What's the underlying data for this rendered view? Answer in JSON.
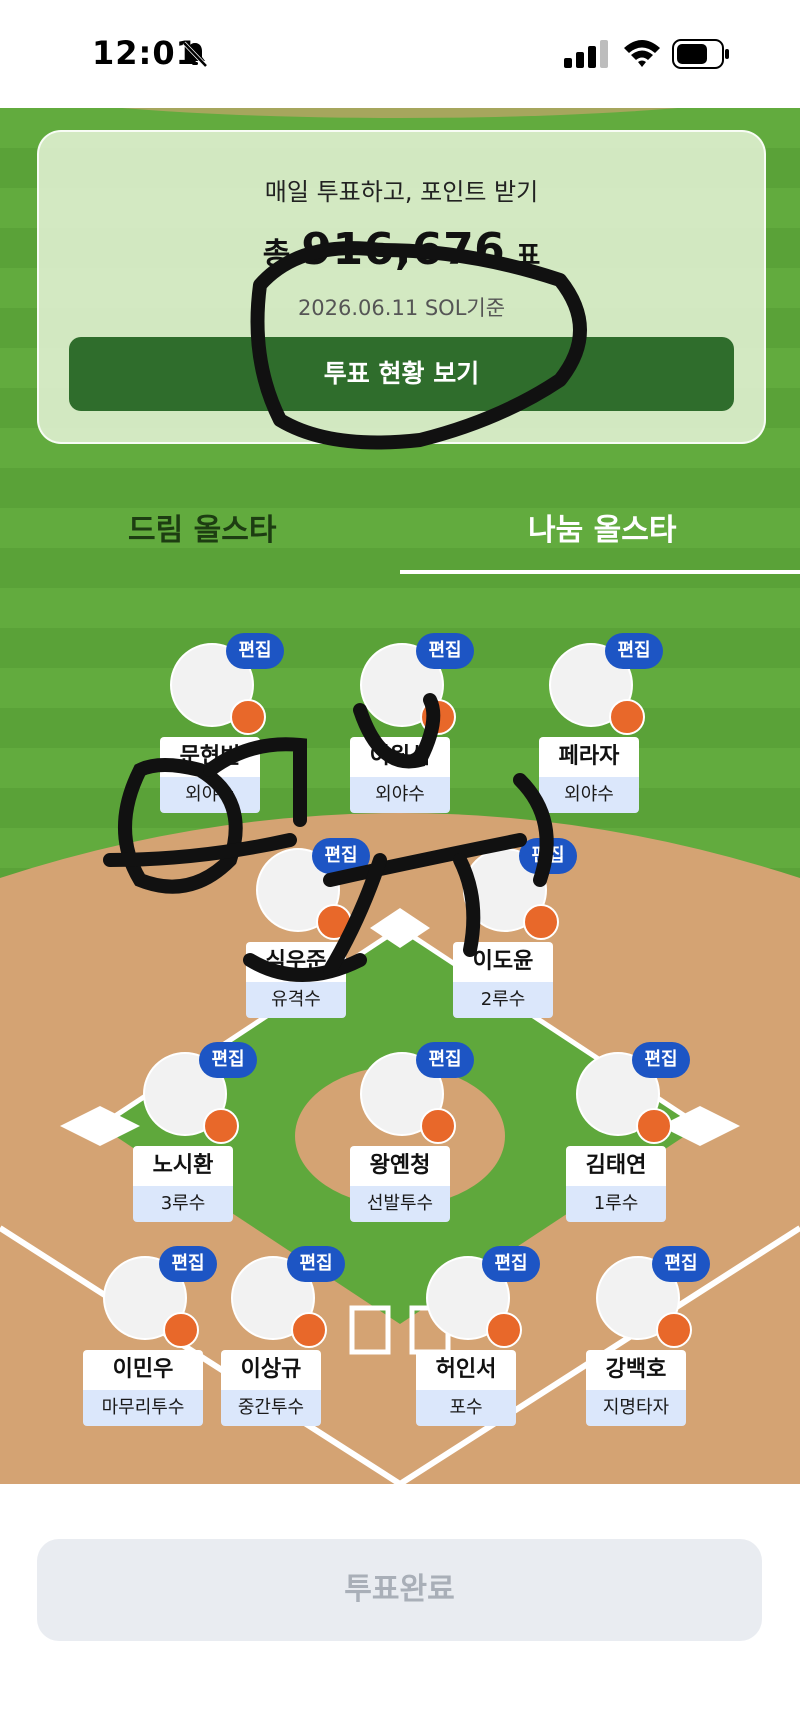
{
  "status_bar": {
    "time": "12:01"
  },
  "vote_card": {
    "title": "매일 투표하고, 포인트 받기",
    "total_prefix": "총",
    "total_count": "916,676",
    "total_suffix": "표",
    "date": "2026.06.11 SOL기준",
    "status_button": "투표 현황 보기"
  },
  "tabs": [
    {
      "label": "드림 올스타",
      "active": false
    },
    {
      "label": "나눔 올스타",
      "active": true
    }
  ],
  "edit_label": "편집",
  "players": [
    {
      "name": "문현빈",
      "position": "외야수"
    },
    {
      "name": "이원석",
      "position": "외야수"
    },
    {
      "name": "페라자",
      "position": "외야수"
    },
    {
      "name": "심우준",
      "position": "유격수"
    },
    {
      "name": "이도윤",
      "position": "2루수"
    },
    {
      "name": "노시환",
      "position": "3루수"
    },
    {
      "name": "왕옌청",
      "position": "선발투수"
    },
    {
      "name": "김태연",
      "position": "1루수"
    },
    {
      "name": "이민우",
      "position": "마무리투수"
    },
    {
      "name": "이상규",
      "position": "중간투수"
    },
    {
      "name": "허인서",
      "position": "포수"
    },
    {
      "name": "강백호",
      "position": "지명타자"
    }
  ],
  "complete_button": "투표완료",
  "colors": {
    "grass": "#5fa83c",
    "infield_dirt": "#d4a373",
    "edit_badge": "#1d55c4",
    "status_button": "#2f6d2c",
    "position_tag": "#dbe7fb"
  }
}
